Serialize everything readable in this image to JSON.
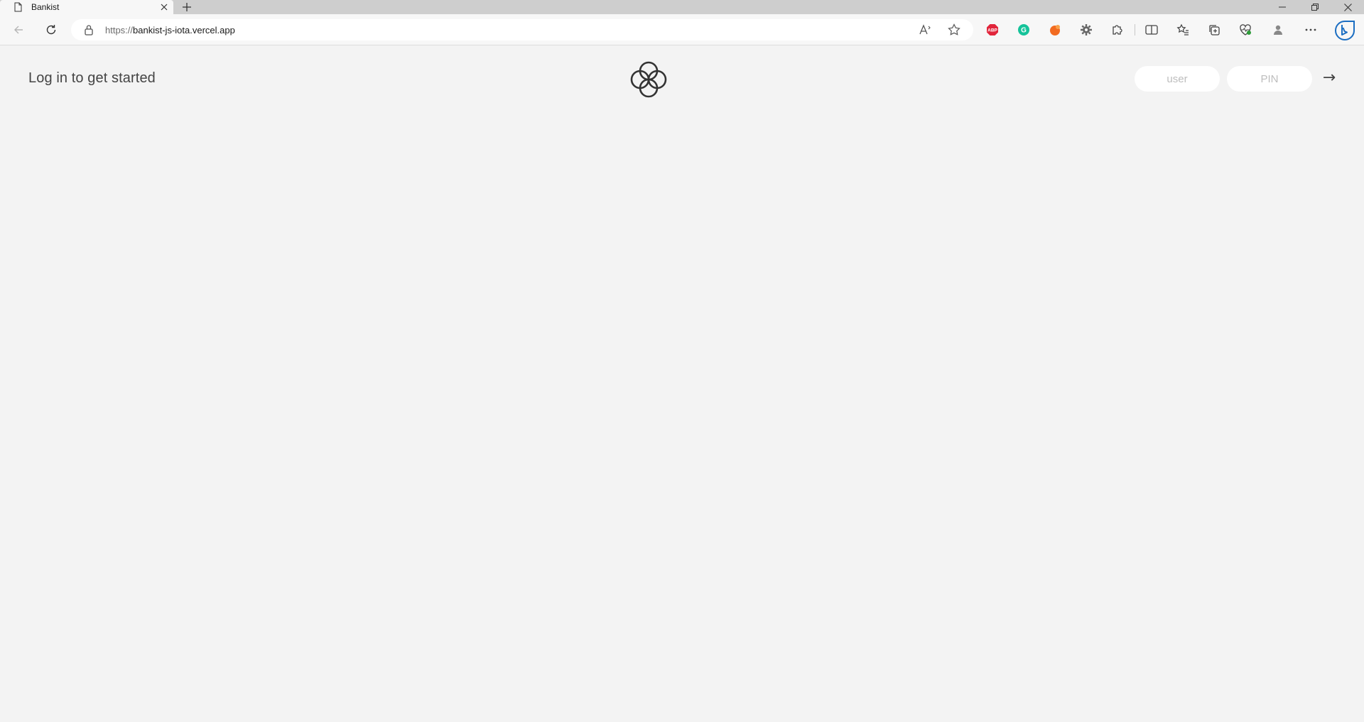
{
  "browser": {
    "tab": {
      "title": "Bankist",
      "icon": "page-icon"
    },
    "address": {
      "scheme": "https://",
      "host": "bankist-js-iota.vercel.app"
    },
    "extensions": [
      {
        "name": "adblock-plus-icon",
        "label": "ABP",
        "color": "#e1253b"
      },
      {
        "name": "grammarly-icon",
        "label": "G",
        "color": "#15c39a"
      },
      {
        "name": "extension-orange-icon",
        "color": "#f26b21"
      },
      {
        "name": "settings-gear-icon",
        "color": "#666666"
      }
    ]
  },
  "page": {
    "welcome": "Log in to get started",
    "login": {
      "user_placeholder": "user",
      "pin_placeholder": "PIN",
      "submit_label": "→"
    },
    "colors": {
      "background": "#f3f3f3",
      "text": "#444444",
      "logo": "#333333"
    }
  }
}
